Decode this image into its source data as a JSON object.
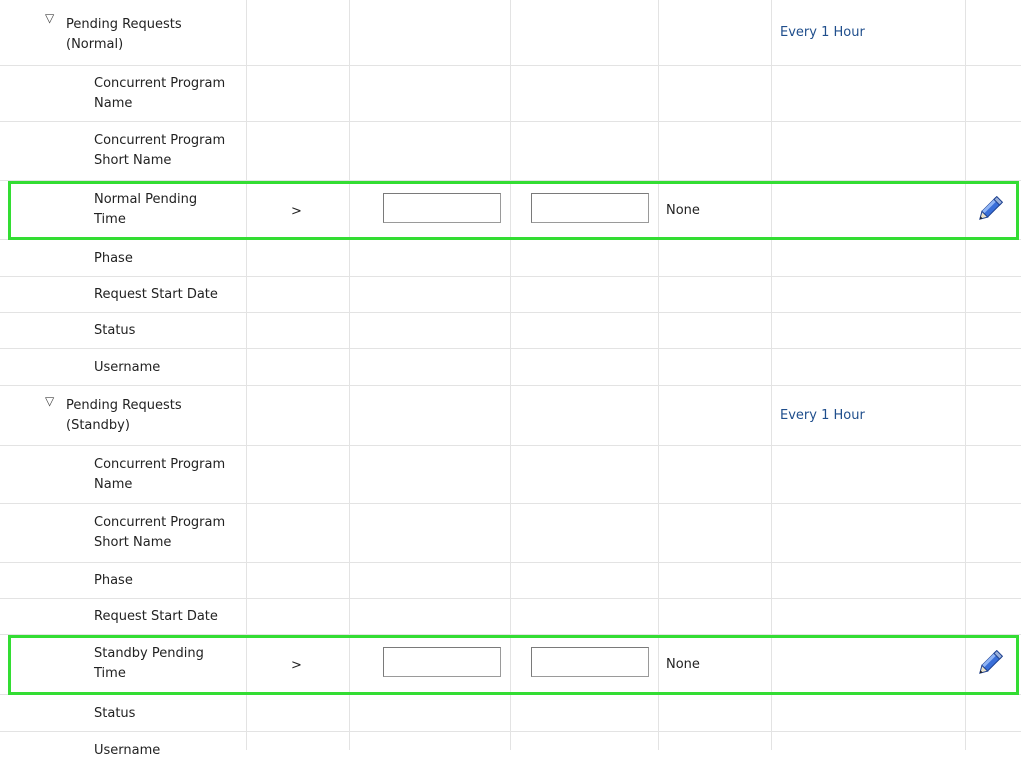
{
  "groups": [
    {
      "title": "Pending Requests",
      "subtitle": "(Normal)",
      "toggle": "▽",
      "frequency": "Every 1 Hour",
      "rows": [
        {
          "name_1": "Concurrent Program",
          "name_2": "Name"
        },
        {
          "name_1": "Concurrent Program",
          "name_2": "Short Name"
        },
        {
          "name_1": "Normal Pending",
          "name_2": "Time",
          "operator": ">",
          "min_value": "",
          "max_value": "",
          "severity": "None",
          "edit_icon": "pencil-icon"
        },
        {
          "name_1": "Phase"
        },
        {
          "name_1": "Request Start Date"
        },
        {
          "name_1": "Status"
        },
        {
          "name_1": "Username"
        }
      ]
    },
    {
      "title": "Pending Requests",
      "subtitle": "(Standby)",
      "toggle": "▽",
      "frequency": "Every 1 Hour",
      "rows": [
        {
          "name_1": "Concurrent Program",
          "name_2": "Name"
        },
        {
          "name_1": "Concurrent Program",
          "name_2": "Short Name"
        },
        {
          "name_1": "Phase"
        },
        {
          "name_1": "Request Start Date"
        },
        {
          "name_1": "Standby Pending",
          "name_2": "Time",
          "operator": ">",
          "min_value": "",
          "max_value": "",
          "severity": "None",
          "edit_icon": "pencil-icon"
        },
        {
          "name_1": "Status"
        },
        {
          "name_1": "Username"
        }
      ]
    }
  ],
  "colors": {
    "highlight": "#33dd33",
    "link": "#1f4e8c",
    "grid": "#e3e3e3"
  }
}
